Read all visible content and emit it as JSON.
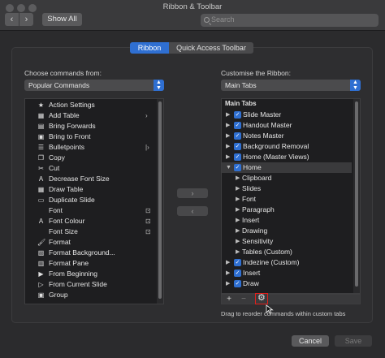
{
  "window": {
    "title": "Ribbon & Toolbar"
  },
  "toolbar": {
    "back": "‹",
    "forward": "›",
    "show_all": "Show All",
    "search_placeholder": "Search"
  },
  "tabs": {
    "ribbon": "Ribbon",
    "qat": "Quick Access Toolbar"
  },
  "left": {
    "label": "Choose commands from:",
    "dropdown": "Popular Commands",
    "items": [
      {
        "label": "Action Settings",
        "icon": "★",
        "icon_name": "action-settings-icon",
        "sub": ""
      },
      {
        "label": "Add Table",
        "icon": "▦",
        "icon_name": "table-icon",
        "sub": "›"
      },
      {
        "label": "Bring Forwards",
        "icon": "▤",
        "icon_name": "bring-forwards-icon",
        "sub": ""
      },
      {
        "label": "Bring to Front",
        "icon": "▣",
        "icon_name": "bring-front-icon",
        "sub": ""
      },
      {
        "label": "Bulletpoints",
        "icon": "☰",
        "icon_name": "bullets-icon",
        "sub": "|›"
      },
      {
        "label": "Copy",
        "icon": "❐",
        "icon_name": "copy-icon",
        "sub": ""
      },
      {
        "label": "Cut",
        "icon": "✂",
        "icon_name": "cut-icon",
        "sub": ""
      },
      {
        "label": "Decrease Font Size",
        "icon": "A",
        "icon_name": "decrease-font-icon",
        "sub": ""
      },
      {
        "label": "Draw Table",
        "icon": "▦",
        "icon_name": "draw-table-icon",
        "sub": ""
      },
      {
        "label": "Duplicate Slide",
        "icon": "▭",
        "icon_name": "duplicate-slide-icon",
        "sub": ""
      },
      {
        "label": "Font",
        "icon": "",
        "icon_name": "font-icon",
        "sub": "⊡"
      },
      {
        "label": "Font Colour",
        "icon": "A",
        "icon_name": "font-colour-icon",
        "sub": "⊡"
      },
      {
        "label": "Font Size",
        "icon": "",
        "icon_name": "font-size-icon",
        "sub": "⊡"
      },
      {
        "label": "Format",
        "icon": "🖌",
        "icon_name": "format-painter-icon",
        "sub": ""
      },
      {
        "label": "Format Background...",
        "icon": "▨",
        "icon_name": "format-background-icon",
        "sub": ""
      },
      {
        "label": "Format Pane",
        "icon": "▥",
        "icon_name": "format-pane-icon",
        "sub": ""
      },
      {
        "label": "From Beginning",
        "icon": "▶",
        "icon_name": "from-beginning-icon",
        "sub": ""
      },
      {
        "label": "From Current Slide",
        "icon": "▷",
        "icon_name": "from-current-icon",
        "sub": ""
      },
      {
        "label": "Group",
        "icon": "▣",
        "icon_name": "group-icon",
        "sub": ""
      },
      {
        "label": "",
        "icon": "▪",
        "icon_name": "more-icon",
        "sub": ""
      }
    ]
  },
  "move": {
    "add": "›",
    "remove": "‹"
  },
  "right": {
    "label": "Customise the Ribbon:",
    "dropdown": "Main Tabs",
    "header": "Main Tabs",
    "items": [
      {
        "label": "Slide Master",
        "level": 0,
        "checked": true,
        "expanded": false,
        "selected": false
      },
      {
        "label": "Handout Master",
        "level": 0,
        "checked": true,
        "expanded": false,
        "selected": false
      },
      {
        "label": "Notes Master",
        "level": 0,
        "checked": true,
        "expanded": false,
        "selected": false
      },
      {
        "label": "Background Removal",
        "level": 0,
        "checked": true,
        "expanded": false,
        "selected": false
      },
      {
        "label": "Home (Master Views)",
        "level": 0,
        "checked": true,
        "expanded": false,
        "selected": false
      },
      {
        "label": "Home",
        "level": 0,
        "checked": true,
        "expanded": true,
        "selected": true
      },
      {
        "label": "Clipboard",
        "level": 1,
        "checked": false,
        "expanded": false,
        "selected": false
      },
      {
        "label": "Slides",
        "level": 1,
        "checked": false,
        "expanded": false,
        "selected": false
      },
      {
        "label": "Font",
        "level": 1,
        "checked": false,
        "expanded": false,
        "selected": false
      },
      {
        "label": "Paragraph",
        "level": 1,
        "checked": false,
        "expanded": false,
        "selected": false
      },
      {
        "label": "Insert",
        "level": 1,
        "checked": false,
        "expanded": false,
        "selected": false
      },
      {
        "label": "Drawing",
        "level": 1,
        "checked": false,
        "expanded": false,
        "selected": false
      },
      {
        "label": "Sensitivity",
        "level": 1,
        "checked": false,
        "expanded": false,
        "selected": false
      },
      {
        "label": "Tables (Custom)",
        "level": 1,
        "checked": false,
        "expanded": false,
        "selected": false
      },
      {
        "label": "Indezine (Custom)",
        "level": 0,
        "checked": true,
        "expanded": false,
        "selected": false
      },
      {
        "label": "Insert",
        "level": 0,
        "checked": true,
        "expanded": false,
        "selected": false
      },
      {
        "label": "Draw",
        "level": 0,
        "checked": true,
        "expanded": false,
        "selected": false
      }
    ],
    "add_btn": "+",
    "remove_btn": "−",
    "gear": "⚙",
    "hint": "Drag to reorder commands within custom tabs"
  },
  "footer": {
    "cancel": "Cancel",
    "save": "Save"
  },
  "colors": {
    "accent": "#2f6fd1",
    "highlight": "#e0201c"
  }
}
